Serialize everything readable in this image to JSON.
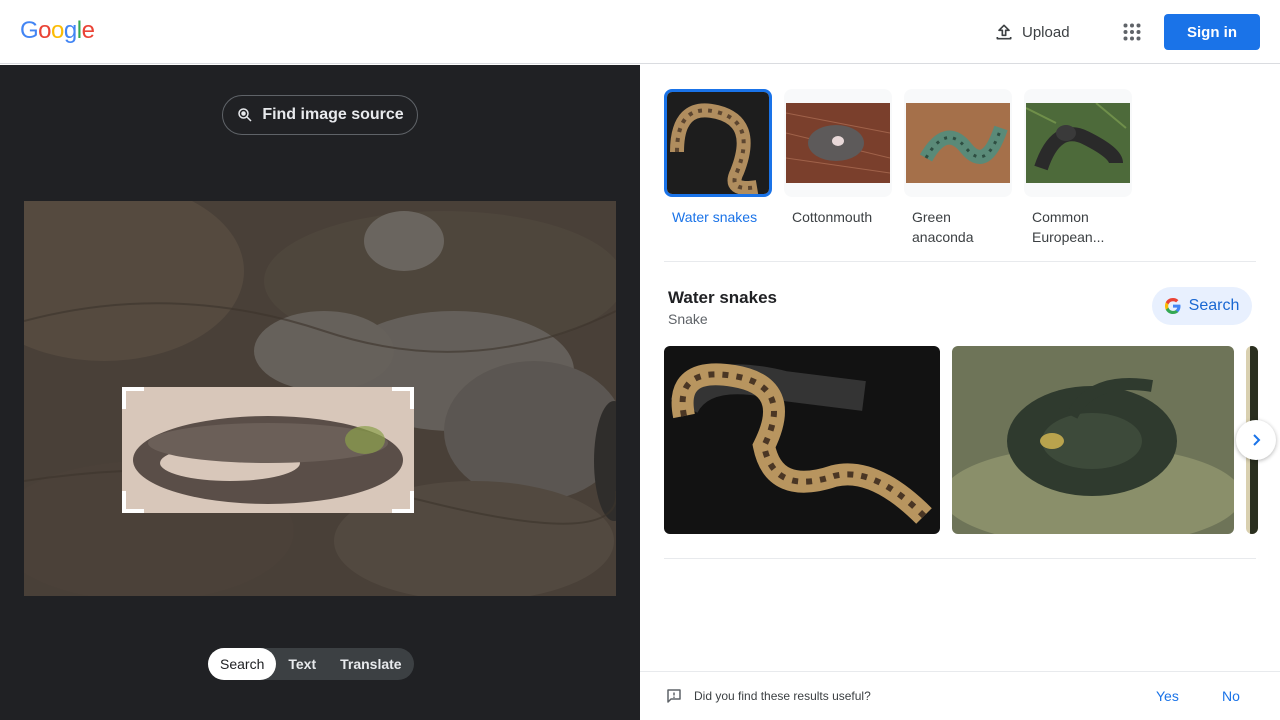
{
  "header": {
    "logo_letters": [
      {
        "ch": "G",
        "color": "#4285F4"
      },
      {
        "ch": "o",
        "color": "#EA4335"
      },
      {
        "ch": "o",
        "color": "#FBBC05"
      },
      {
        "ch": "g",
        "color": "#4285F4"
      },
      {
        "ch": "l",
        "color": "#34A853"
      },
      {
        "ch": "e",
        "color": "#EA4335"
      }
    ],
    "upload_label": "Upload",
    "upload_icon": "upload-icon",
    "apps_icon": "apps-grid-icon",
    "signin_label": "Sign in"
  },
  "left_panel": {
    "find_source_label": "Find image source",
    "find_source_icon": "image-search-icon",
    "mode_tabs": [
      {
        "label": "Search",
        "active": true
      },
      {
        "label": "Text",
        "active": false
      },
      {
        "label": "Translate",
        "active": false
      }
    ]
  },
  "right_panel": {
    "chips": [
      {
        "label": "Water snakes",
        "active": true
      },
      {
        "label": "Cottonmouth",
        "active": false
      },
      {
        "label": "Green anaconda",
        "active": false
      },
      {
        "label": "Common European...",
        "active": false
      }
    ],
    "entity": {
      "title": "Water snakes",
      "subtitle": "Snake",
      "search_label": "Search"
    }
  },
  "feedback": {
    "question": "Did you find these results useful?",
    "yes_label": "Yes",
    "no_label": "No"
  },
  "colors": {
    "accent": "#1a73e8",
    "dark_panel": "#202124"
  }
}
